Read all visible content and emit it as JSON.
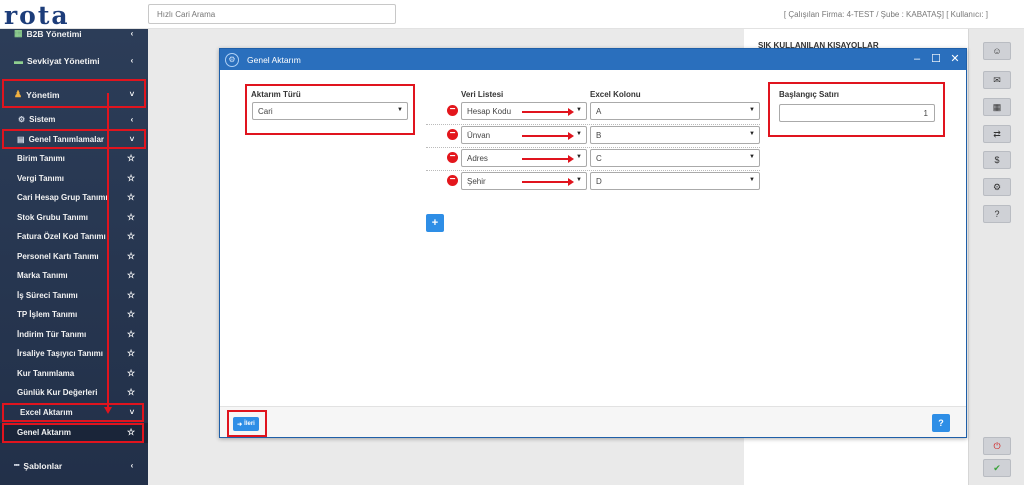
{
  "topbar": {
    "logo": "rota",
    "search_placeholder": "Hızlı Cari Arama",
    "company_info": "[ Çalışılan Firma: 4-TEST / Şube : KABATAŞ] [ Kullanıcı:              ]"
  },
  "sidebar": {
    "partial_top": "B2B Yönetimi",
    "sevkiyat": "Sevkiyat Yönetimi",
    "yonetim": "Yönetim",
    "sistem": "Sistem",
    "genel_tanimlamalar": "Genel Tanımlamalar",
    "items": [
      "Birim Tanımı",
      "Vergi Tanımı",
      "Cari Hesap Grup Tanımı",
      "Stok Grubu Tanımı",
      "Fatura Özel Kod Tanımı",
      "Personel Kartı Tanımı",
      "Marka Tanımı",
      "İş Süreci Tanımı",
      "TP İşlem Tanımı",
      "İndirim Tür Tanımı",
      "İrsaliye Taşıyıcı Tanımı",
      "Kur Tanımlama",
      "Günlük Kur Değerleri"
    ],
    "excel_aktarim": "Excel Aktarım",
    "genel_aktarim": "Genel Aktarım",
    "sablonlar": "Şablonlar"
  },
  "right_panel": {
    "shortcut_title": "SIK KULLANILAN KISAYOLLAR"
  },
  "dialog": {
    "title": "Genel Aktarım",
    "aktarim_turu_label": "Aktarım Türü",
    "aktarim_turu_value": "Cari",
    "veri_listesi_label": "Veri Listesi",
    "excel_kolonu_label": "Excel Kolonu",
    "mappings": [
      {
        "field": "Hesap Kodu",
        "column": "A"
      },
      {
        "field": "Ünvan",
        "column": "B"
      },
      {
        "field": "Adres",
        "column": "C"
      },
      {
        "field": "Şehir",
        "column": "D"
      }
    ],
    "baslangic_satiri_label": "Başlangıç Satırı",
    "baslangic_satiri_value": "1",
    "add_label": "+",
    "next_label": "İleri",
    "help_label": "?"
  },
  "colors": {
    "accent": "#2a6fbd",
    "highlight": "#e0141e",
    "sidebar_bg": "#2c3d58"
  }
}
